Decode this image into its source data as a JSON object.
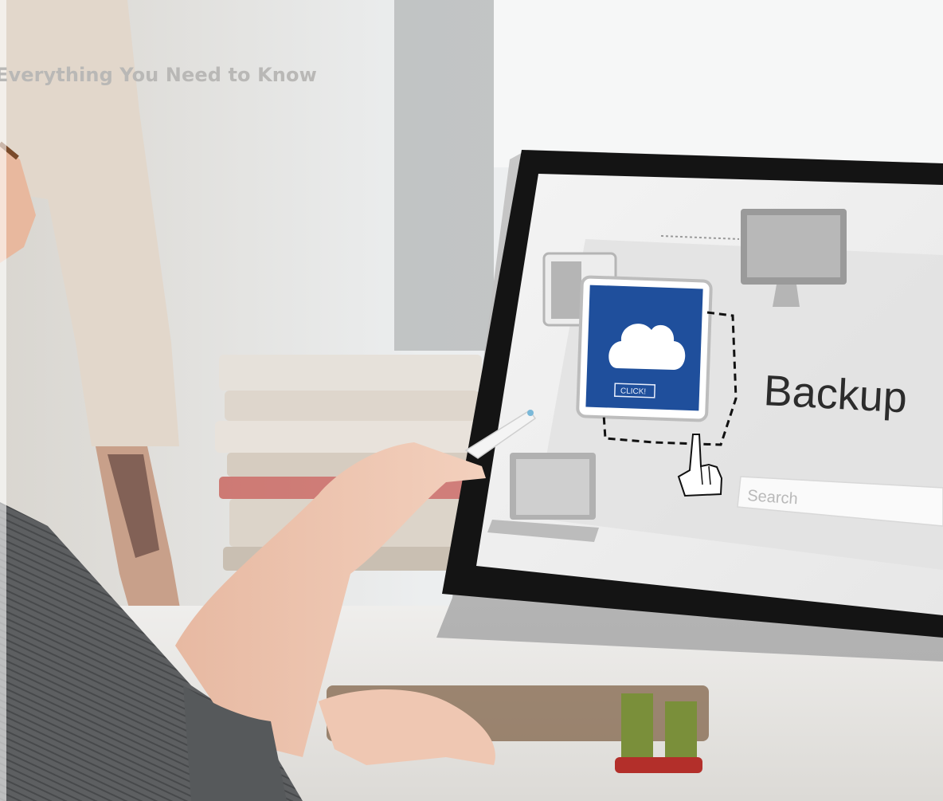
{
  "heading": "Everything You Need to Know",
  "screen": {
    "title": "Backup",
    "click_label": "CLICK!",
    "search_placeholder": "Search"
  },
  "icons": {
    "cloud": "cloud-icon",
    "hand": "hand-pointer-icon",
    "monitor": "monitor-icon",
    "laptop": "laptop-icon"
  },
  "colors": {
    "tile_blue": "#1f4f9c",
    "monitor_bezel": "#141414",
    "heading": "#b9b8b6"
  }
}
